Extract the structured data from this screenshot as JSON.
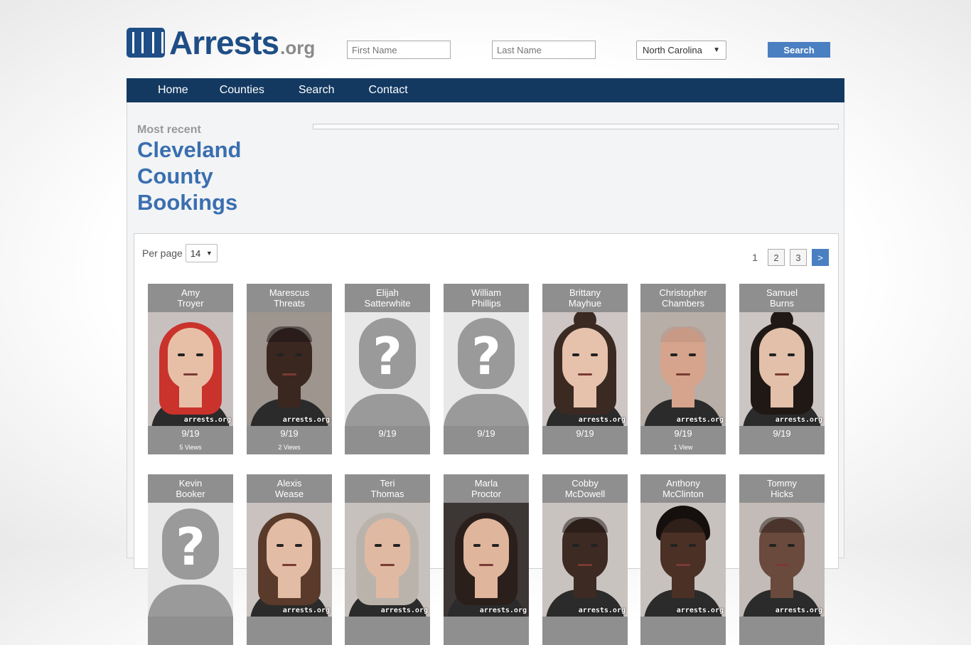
{
  "header": {
    "logo_text": "Arrests",
    "logo_suffix": ".org",
    "first_name_placeholder": "First Name",
    "last_name_placeholder": "Last Name",
    "state_selected": "North Carolina",
    "search_label": "Search"
  },
  "nav": {
    "items": [
      "Home",
      "Counties",
      "Search",
      "Contact"
    ]
  },
  "page": {
    "most_recent": "Most recent",
    "title_line1": "Cleveland",
    "title_line2": "County",
    "title_line3": "Bookings"
  },
  "controls": {
    "per_page_label": "Per page",
    "per_page_value": "14",
    "pages": [
      "1",
      "2",
      "3"
    ],
    "next": ">"
  },
  "watermark": "arrests.org",
  "bookings": [
    {
      "first": "Amy",
      "last": "Troyer",
      "date": "9/19",
      "views": "5 Views",
      "photo": "hair-red",
      "skin": "#e7bfa6",
      "hair": "#c9332c",
      "bg": "#c8c0bf"
    },
    {
      "first": "Marescus",
      "last": "Threats",
      "date": "9/19",
      "views": "2 Views",
      "photo": "bald-dark",
      "skin": "#3a2720",
      "hair": "#1a1210",
      "bg": "#9d958e"
    },
    {
      "first": "Elijah",
      "last": "Satterwhite",
      "date": "9/19",
      "views": "",
      "photo": "unknown"
    },
    {
      "first": "William",
      "last": "Phillips",
      "date": "9/19",
      "views": "",
      "photo": "unknown"
    },
    {
      "first": "Brittany",
      "last": "Mayhue",
      "date": "9/19",
      "views": "",
      "photo": "bun-brown",
      "skin": "#e6c2ad",
      "hair": "#3b2a22",
      "bg": "#cdc6c4"
    },
    {
      "first": "Christopher",
      "last": "Chambers",
      "date": "9/19",
      "views": "1 View",
      "photo": "bald-light",
      "skin": "#d6a48d",
      "hair": "#b98f7f",
      "bg": "#b8aea8"
    },
    {
      "first": "Samuel",
      "last": "Burns",
      "date": "9/19",
      "views": "",
      "photo": "bun-dark",
      "skin": "#e2c0aa",
      "hair": "#201815",
      "bg": "#cbc5c3"
    },
    {
      "first": "Kevin",
      "last": "Booker",
      "date": "",
      "views": "",
      "photo": "unknown"
    },
    {
      "first": "Alexis",
      "last": "Wease",
      "date": "",
      "views": "",
      "photo": "hair-brown",
      "skin": "#e3bca5",
      "hair": "#5a3a2a",
      "bg": "#c9c2bf"
    },
    {
      "first": "Teri",
      "last": "Thomas",
      "date": "",
      "views": "",
      "photo": "hair-grey",
      "skin": "#e0b9a3",
      "hair": "#b9b3ac",
      "bg": "#c7c1be"
    },
    {
      "first": "Marla",
      "last": "Proctor",
      "date": "",
      "views": "",
      "photo": "hair-dark",
      "skin": "#dfb59c",
      "hair": "#2a1f1b",
      "bg": "#3c3634"
    },
    {
      "first": "Cobby",
      "last": "McDowell",
      "date": "",
      "views": "",
      "photo": "bald-dark",
      "skin": "#3d2a22",
      "hair": "#1b1311",
      "bg": "#c9c3c0"
    },
    {
      "first": "Anthony",
      "last": "McClinton",
      "date": "",
      "views": "",
      "photo": "locs-dark",
      "skin": "#4b3026",
      "hair": "#15100e",
      "bg": "#c8c2bf"
    },
    {
      "first": "Tommy",
      "last": "Hicks",
      "date": "",
      "views": "",
      "photo": "bald-dark",
      "skin": "#6a4a3d",
      "hair": "#2a1e19",
      "bg": "#c2bbb7"
    }
  ]
}
